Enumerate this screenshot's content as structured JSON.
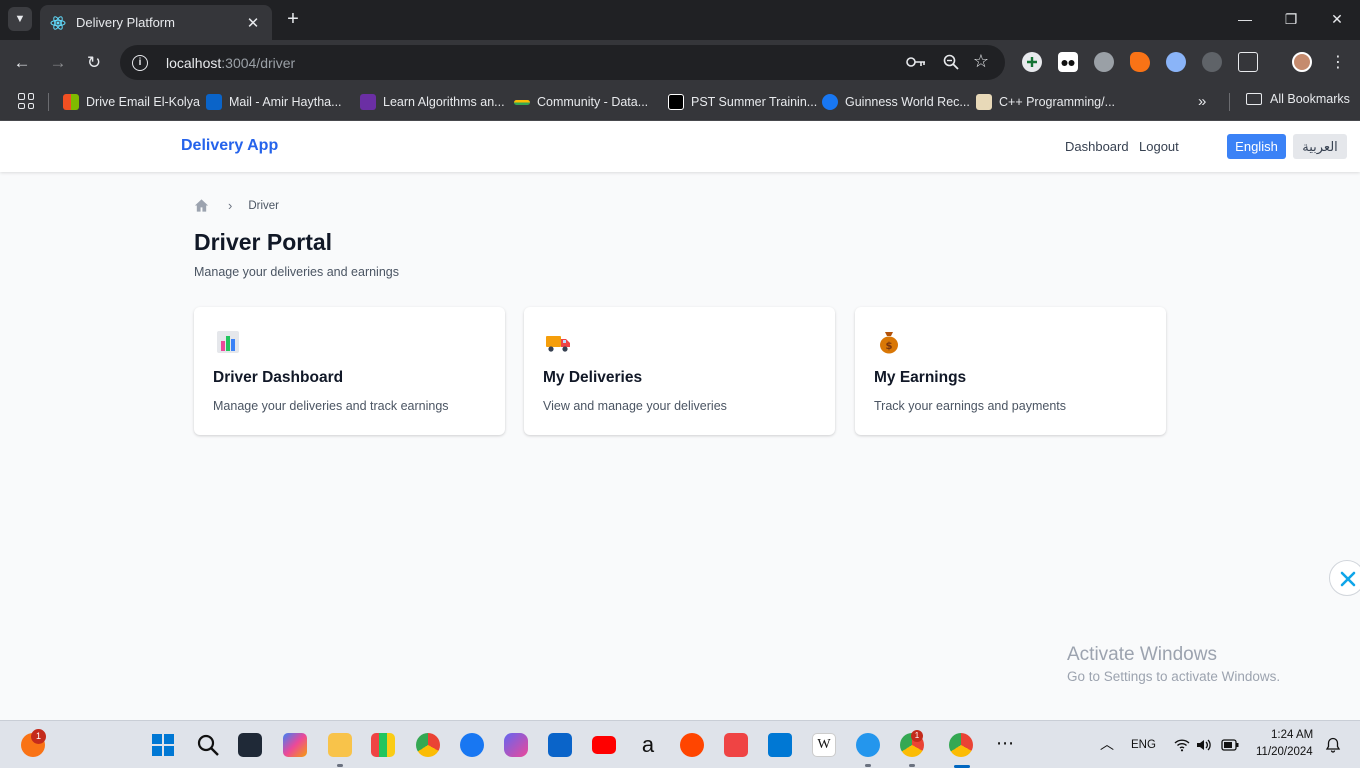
{
  "browser": {
    "tab_title": "Delivery Platform",
    "tab_close": "✕",
    "new_tab": "+",
    "url_host": "localhost",
    "url_path": ":3004/driver",
    "window_controls": {
      "minimize": "—",
      "restore": "❐",
      "close": "✕"
    }
  },
  "bookmarks": {
    "items": [
      "Drive Email El-Kolya",
      "Mail - Amir Haytha...",
      "Learn Algorithms an...",
      "Community - Data...",
      "PST Summer Trainin...",
      "Guinness World Rec...",
      "C++ Programming/..."
    ],
    "more": "»",
    "all_bookmarks": "All Bookmarks"
  },
  "app": {
    "brand": "Delivery App",
    "nav": {
      "dashboard": "Dashboard",
      "logout": "Logout"
    },
    "lang": {
      "english": "English",
      "arabic": "العربية"
    }
  },
  "main": {
    "breadcrumb_current": "Driver",
    "breadcrumb_separator": "›",
    "title": "Driver Portal",
    "subtitle": "Manage your deliveries and earnings",
    "cards": [
      {
        "title": "Driver Dashboard",
        "desc": "Manage your deliveries and track earnings",
        "icon": "chart-icon"
      },
      {
        "title": "My Deliveries",
        "desc": "View and manage your deliveries",
        "icon": "delivery-truck-icon"
      },
      {
        "title": "My Earnings",
        "desc": "Track your earnings and payments",
        "icon": "money-bag-icon"
      }
    ]
  },
  "watermark": {
    "title": "Activate Windows",
    "subtitle": "Go to Settings to activate Windows."
  },
  "taskbar": {
    "notification_count": "1",
    "chrome_badge": "1",
    "language": "ENG",
    "time": "1:24 AM",
    "date": "11/20/2024"
  },
  "colors": {
    "brand": "#2563eb",
    "lang_active": "#3b82f6",
    "page_bg": "#f9fafb"
  }
}
